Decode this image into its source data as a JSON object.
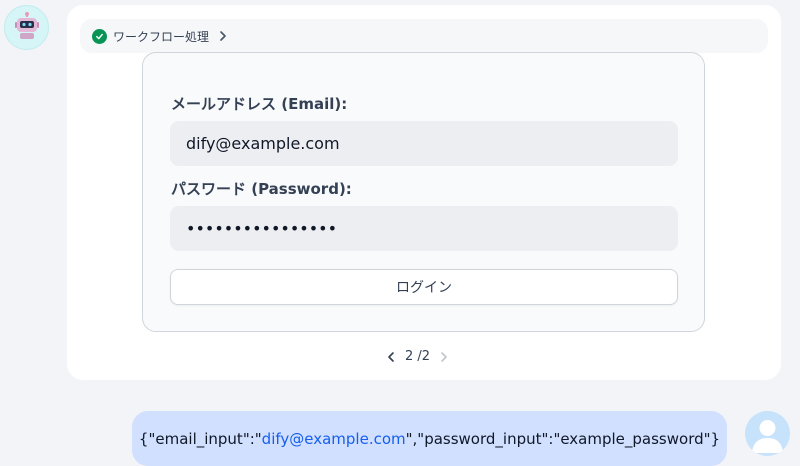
{
  "workflow": {
    "status_label": "ワークフロー処理"
  },
  "form": {
    "email_label": "メールアドレス (Email):",
    "email_value": "dify@example.com",
    "password_label": "パスワード (Password):",
    "password_value": "••••••••••••••••",
    "login_label": "ログイン"
  },
  "pager": {
    "text": "2 /2"
  },
  "user_message": {
    "prefix": "{\"email_input\":\"",
    "email": "dify@example.com",
    "suffix": "\",\"password_input\":\"example_password\"}"
  },
  "colors": {
    "success": "#079455",
    "link": "#155eef",
    "user_bubble": "#d1e0ff"
  },
  "icons": [
    "robot-icon",
    "check-circle-icon",
    "chevron-right-icon",
    "chevron-left-icon",
    "user-icon"
  ]
}
